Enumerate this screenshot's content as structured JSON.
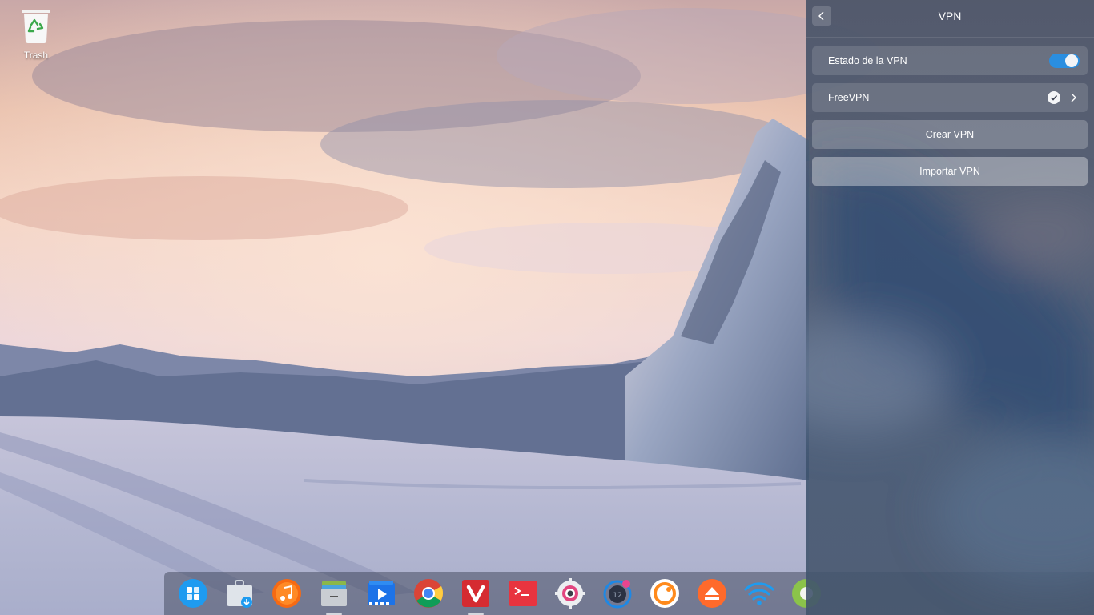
{
  "desktop": {
    "icons": [
      {
        "label": "Trash",
        "icon": "trash-icon"
      }
    ]
  },
  "dock": {
    "apps": [
      {
        "icon": "launcher-icon",
        "color": "#1e9bf0"
      },
      {
        "icon": "app-store-icon",
        "color": "#cfd6de"
      },
      {
        "icon": "music-icon",
        "color": "#f66a13"
      },
      {
        "icon": "file-manager-icon",
        "color": "#8bb74a"
      },
      {
        "icon": "video-player-icon",
        "color": "#1d73e8"
      },
      {
        "icon": "chrome-icon",
        "color": "#db4437"
      },
      {
        "icon": "vivaldi-icon",
        "color": "#d52b31"
      },
      {
        "icon": "terminal-icon",
        "color": "#e8343f"
      },
      {
        "icon": "settings-icon",
        "color": "#eceef1"
      },
      {
        "icon": "notification-calendar-icon",
        "color": "#1e88e5",
        "badge": "12"
      },
      {
        "icon": "deepin-browser-icon",
        "color": "#ff8a1c"
      },
      {
        "icon": "eject-icon",
        "color": "#ff6a2b"
      },
      {
        "icon": "wifi-icon",
        "color": "#1e9bf0"
      },
      {
        "icon": "network-icon",
        "color": "#8bc34a"
      }
    ]
  },
  "vpn_panel": {
    "title": "VPN",
    "back_label": "",
    "status_label": "Estado de la VPN",
    "status_on": true,
    "connection_name": "FreeVPN",
    "connection_selected": true,
    "create_button": "Crear VPN",
    "import_button": "Importar VPN",
    "accent": "#2a8ee0"
  }
}
